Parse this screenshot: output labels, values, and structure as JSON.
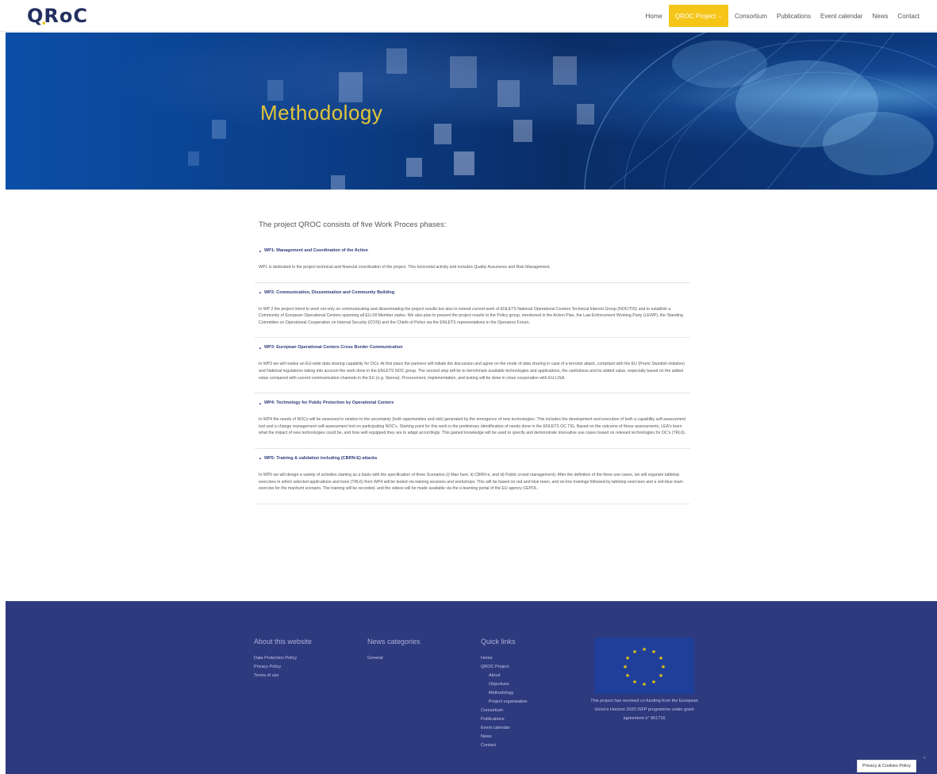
{
  "header": {
    "logo": "QRoC",
    "nav": [
      {
        "label": "Home"
      },
      {
        "label": "QROC Project"
      },
      {
        "label": "Consortium"
      },
      {
        "label": "Publications"
      },
      {
        "label": "Event calendar"
      },
      {
        "label": "News"
      },
      {
        "label": "Contact"
      }
    ],
    "active_color": "#f5c518"
  },
  "hero": {
    "title": "Methodology"
  },
  "content": {
    "intro": "The project QROC consists of five Work Proces phases:",
    "sections": [
      {
        "title": "WP1: Management and Coordination of the Action",
        "body": "WP1 is dedicated to the project technical and financial coordination of the project. This horizontal activity and includes Quality Assurance and Risk Management."
      },
      {
        "title": "WP2: Communication, Dissemination and Community Building",
        "body": "In WP 2 the project intent to work not only on communicating and disseminating the project results but also to extend current work of ENLETS National Operational Centers Technical Interest Group (NOC/TIG) and to establish a Community of European Operational Centers spanning all EU-28 Member states. We also plan to present the project results to the Policy group, mentioned in the Action Plan, the Law Enforcement Working Party (LEWP), the Standing Committee on Operational Cooperation on Internal Security (COSI) and the Chiefs of Police via the ENLETS representatives in the Operators Forum."
      },
      {
        "title": "WP3: European Operational Centers Cross Border Communication",
        "body": "In WP3 we will realise an EU-wide data sharing capability for OCs. At first place the partners will initiate the discussion and agree on the mode of data sharing in case of a terrorist attack, compliant with the EU (Prum/ Swedish initiative) and National regulations taking into account the work done in the ENLETS NOC group. The second step will be to benchmark available technologies and applications, the usefulness and its added value, especially based on the added value compared with current communication channels in the EU (e.g. Sienna). Procurement, implementation, and testing will be done in close cooperation with EU-LISA."
      },
      {
        "title": "WP4: Technology for Public Protection by Operational Centers",
        "body": "In WP4 the needs of NOCs will be assessed in relation to the uncertainty (both opportunities and risk) generated by the emergence of new technologies. This includes the development and execution of both a capability self-assessment tool and a change management self-assessment tool on participating NOC's. Starting point for this work is the preliminary identification of needs done in the ENLETS OC TIG. Based on the outcome of these assessments, LEA's learn what the impact of new technologies could be, and how well equipped they are to adapt accordingly. This gained knowledge will be used to specify and demonstrate innovative use cases based on relevant technologies for OC's (TRL6)."
      },
      {
        "title": "WP5: Training & validation including (CBRN-E) attacks",
        "body": "In WP5 we will design a variety of activities starting as a basis with the specification of three Scenarios (i) Man hunt, ii) CBRN-e, and iii) Public crowd management). After the definition of the three use cases, we will organize tabletop exercises in which selected applications and tools (TRL6) from WP4 will be tested via training sessions and workshops. This will be based on red and blue team, and on-line trainings followed by tabletop exercises and a red-blue team exercise for the manhunt scenario. The training will be recorded, and the videos will be made available via the e-learning portal of the EU agency CEPOL."
      }
    ]
  },
  "footer": {
    "about": {
      "title": "About this website",
      "links": [
        "Data Protection Policy",
        "Privacy Policy",
        "Terms of use"
      ]
    },
    "news": {
      "title": "News categories",
      "links": [
        "General"
      ]
    },
    "quick": {
      "title": "Quick links",
      "links": [
        {
          "label": "Home",
          "sub": false
        },
        {
          "label": "QROC Project",
          "sub": false
        },
        {
          "label": "About",
          "sub": true
        },
        {
          "label": "Objectives",
          "sub": true
        },
        {
          "label": "Methodology",
          "sub": true
        },
        {
          "label": "Project organisation",
          "sub": true
        },
        {
          "label": "Consortium",
          "sub": false
        },
        {
          "label": "Publications",
          "sub": false
        },
        {
          "label": "Event calendar",
          "sub": false
        },
        {
          "label": "News",
          "sub": false
        },
        {
          "label": "Contact",
          "sub": false
        }
      ]
    },
    "eu_text": "This project has received co-funding from the European Union's Horizon 2020 ISFP programme under grant agreement n° 861716",
    "cookie_label": "Privacy & Cookies Policy",
    "footer_color": "#2e3a7e"
  }
}
